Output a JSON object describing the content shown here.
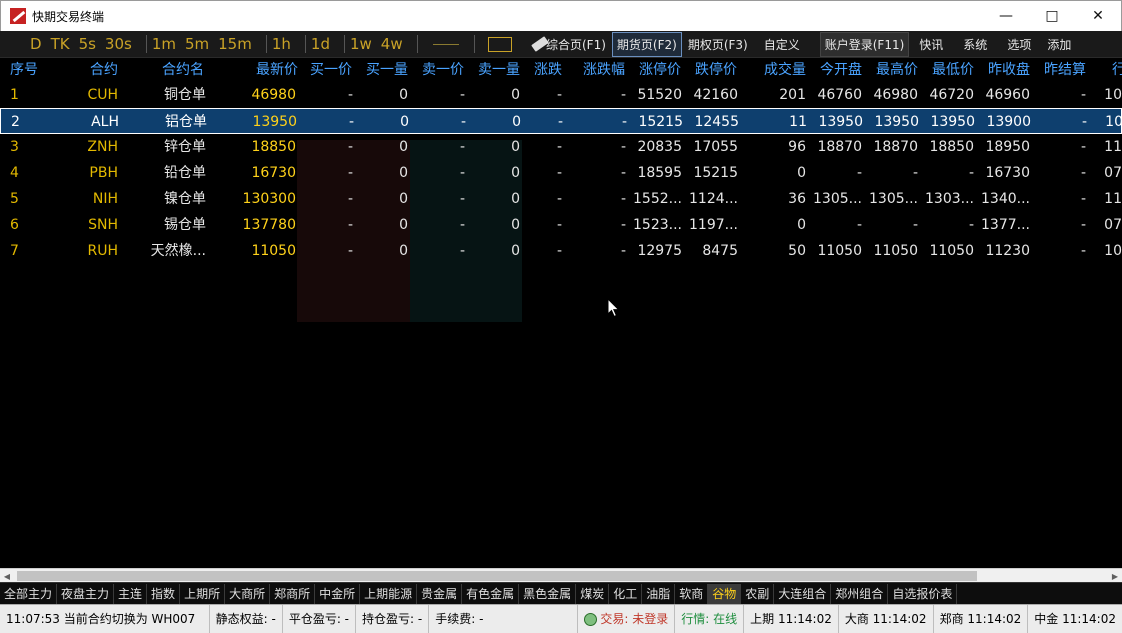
{
  "window": {
    "title": "快期交易终端"
  },
  "toolbar": {
    "periods": [
      "D",
      "TK",
      "5s",
      "30s",
      "1m",
      "5m",
      "15m",
      "1h",
      "1d",
      "1w",
      "4w"
    ],
    "buttons": {
      "overview": "综合页(F1)",
      "futures": "期货页(F2)",
      "options": "期权页(F3)",
      "custom": "自定义",
      "login": "账户登录(F11)",
      "news": "快讯",
      "system": "系统",
      "options_menu": "选项",
      "add": "添加"
    }
  },
  "table": {
    "columns": [
      "序号",
      "合约",
      "合约名",
      "最新价",
      "买一价",
      "买一量",
      "卖一价",
      "卖一量",
      "涨跌",
      "涨跌幅",
      "涨停价",
      "跌停价",
      "成交量",
      "今开盘",
      "最高价",
      "最低价",
      "昨收盘",
      "昨结算",
      "行"
    ],
    "rows": [
      [
        "1",
        "CUH",
        "铜仓单",
        "46980",
        "-",
        "0",
        "-",
        "0",
        "-",
        "-",
        "51520",
        "42160",
        "201",
        "46760",
        "46980",
        "46720",
        "46960",
        "-",
        "10"
      ],
      [
        "2",
        "ALH",
        "铝仓单",
        "13950",
        "-",
        "0",
        "-",
        "0",
        "-",
        "-",
        "15215",
        "12455",
        "11",
        "13950",
        "13950",
        "13950",
        "13900",
        "-",
        "10"
      ],
      [
        "3",
        "ZNH",
        "锌仓单",
        "18850",
        "-",
        "0",
        "-",
        "0",
        "-",
        "-",
        "20835",
        "17055",
        "96",
        "18870",
        "18870",
        "18850",
        "18950",
        "-",
        "11"
      ],
      [
        "4",
        "PBH",
        "铅仓单",
        "16730",
        "-",
        "0",
        "-",
        "0",
        "-",
        "-",
        "18595",
        "15215",
        "0",
        "-",
        "-",
        "-",
        "16730",
        "-",
        "07"
      ],
      [
        "5",
        "NIH",
        "镍仓单",
        "130300",
        "-",
        "0",
        "-",
        "0",
        "-",
        "-",
        "1552...",
        "1124...",
        "36",
        "1305...",
        "1305...",
        "1303...",
        "1340...",
        "-",
        "11"
      ],
      [
        "6",
        "SNH",
        "锡仓单",
        "137780",
        "-",
        "0",
        "-",
        "0",
        "-",
        "-",
        "1523...",
        "1197...",
        "0",
        "-",
        "-",
        "-",
        "1377...",
        "-",
        "07"
      ],
      [
        "7",
        "RUH",
        "天然橡...",
        "11050",
        "-",
        "0",
        "-",
        "0",
        "-",
        "-",
        "12975",
        "8475",
        "50",
        "11050",
        "11050",
        "11050",
        "11230",
        "-",
        "10"
      ]
    ],
    "selected_row": 1
  },
  "market_tabs": [
    "全部主力",
    "夜盘主力",
    "主连",
    "指数",
    "上期所",
    "大商所",
    "郑商所",
    "中金所",
    "上期能源",
    "贵金属",
    "有色金属",
    "黑色金属",
    "煤炭",
    "化工",
    "油脂",
    "软商",
    "谷物",
    "农副",
    "大连组合",
    "郑州组合",
    "自选报价表"
  ],
  "active_market_tab": "谷物",
  "status": {
    "message": "11:07:53 当前合约切换为 WH007",
    "static_equity": "静态权益: -",
    "close_pnl": "平仓盈亏: -",
    "position_pnl": "持仓盈亏: -",
    "fee": "手续费: -",
    "trade_label": "交易: 未登录",
    "quote_label": "行情: 在线",
    "shfe_time": "上期 11:14:02",
    "dce_time": "大商 11:14:02",
    "czce_time": "郑商 11:14:02",
    "cffex_time": "中金 11:14:02"
  }
}
